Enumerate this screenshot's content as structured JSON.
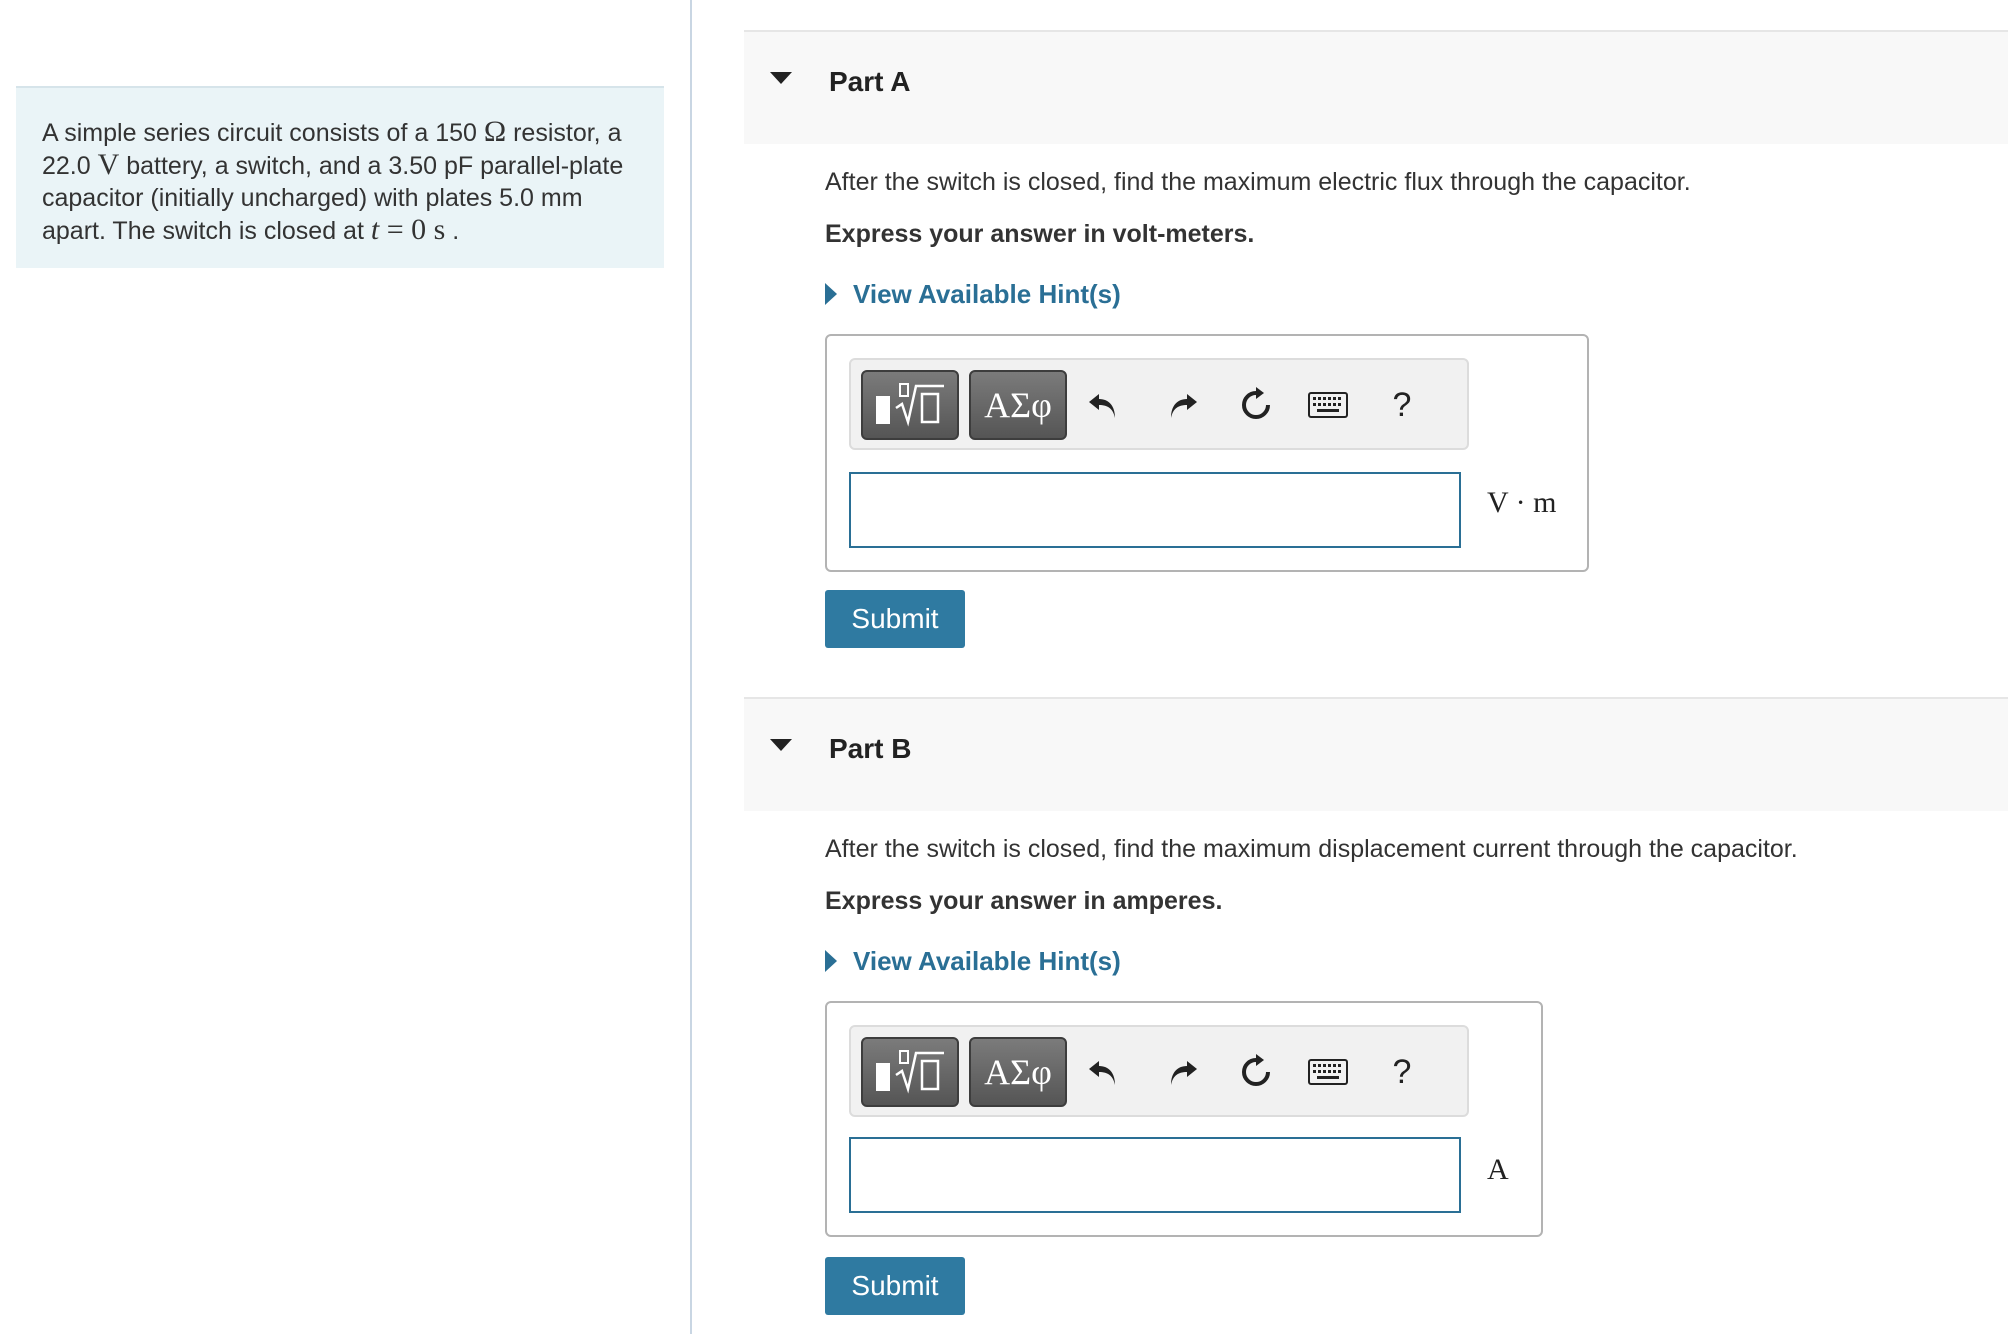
{
  "problem": {
    "t1": "A simple series circuit consists of a 150 ",
    "ohm": "Ω",
    "t2": " resistor, a 22.0 ",
    "volt": "V",
    "t3": " battery, a switch, and a 3.50 pF parallel-plate capacitor (initially uncharged) with plates 5.0 mm apart. The switch is closed at ",
    "tvar": "t",
    "eq": " = 0 s",
    "end": " ."
  },
  "parts": [
    {
      "title": "Part A",
      "question": "After the switch is closed, find the maximum electric flux through the capacitor.",
      "express": "Express your answer in volt-meters.",
      "hint": "View Available Hint(s)",
      "unit": "V · m",
      "input_value": "",
      "submit": "Submit"
    },
    {
      "title": "Part B",
      "question": "After the switch is closed, find the maximum displacement current through the capacitor.",
      "express": "Express your answer in amperes.",
      "hint": "View Available Hint(s)",
      "unit": "A",
      "input_value": "",
      "submit": "Submit"
    }
  ],
  "toolbar": {
    "symbols_label": "ΑΣφ",
    "help_label": "?"
  },
  "icons": {
    "templates": "templates-icon",
    "undo": "undo-icon",
    "redo": "redo-icon",
    "reset": "reset-icon",
    "keyboard": "keyboard-icon",
    "caret": "caret-down-icon",
    "hint": "caret-right-icon"
  },
  "colors": {
    "accent": "#2a6f95",
    "button": "#2f7aa1",
    "problem_bg": "#eaf4f7"
  }
}
